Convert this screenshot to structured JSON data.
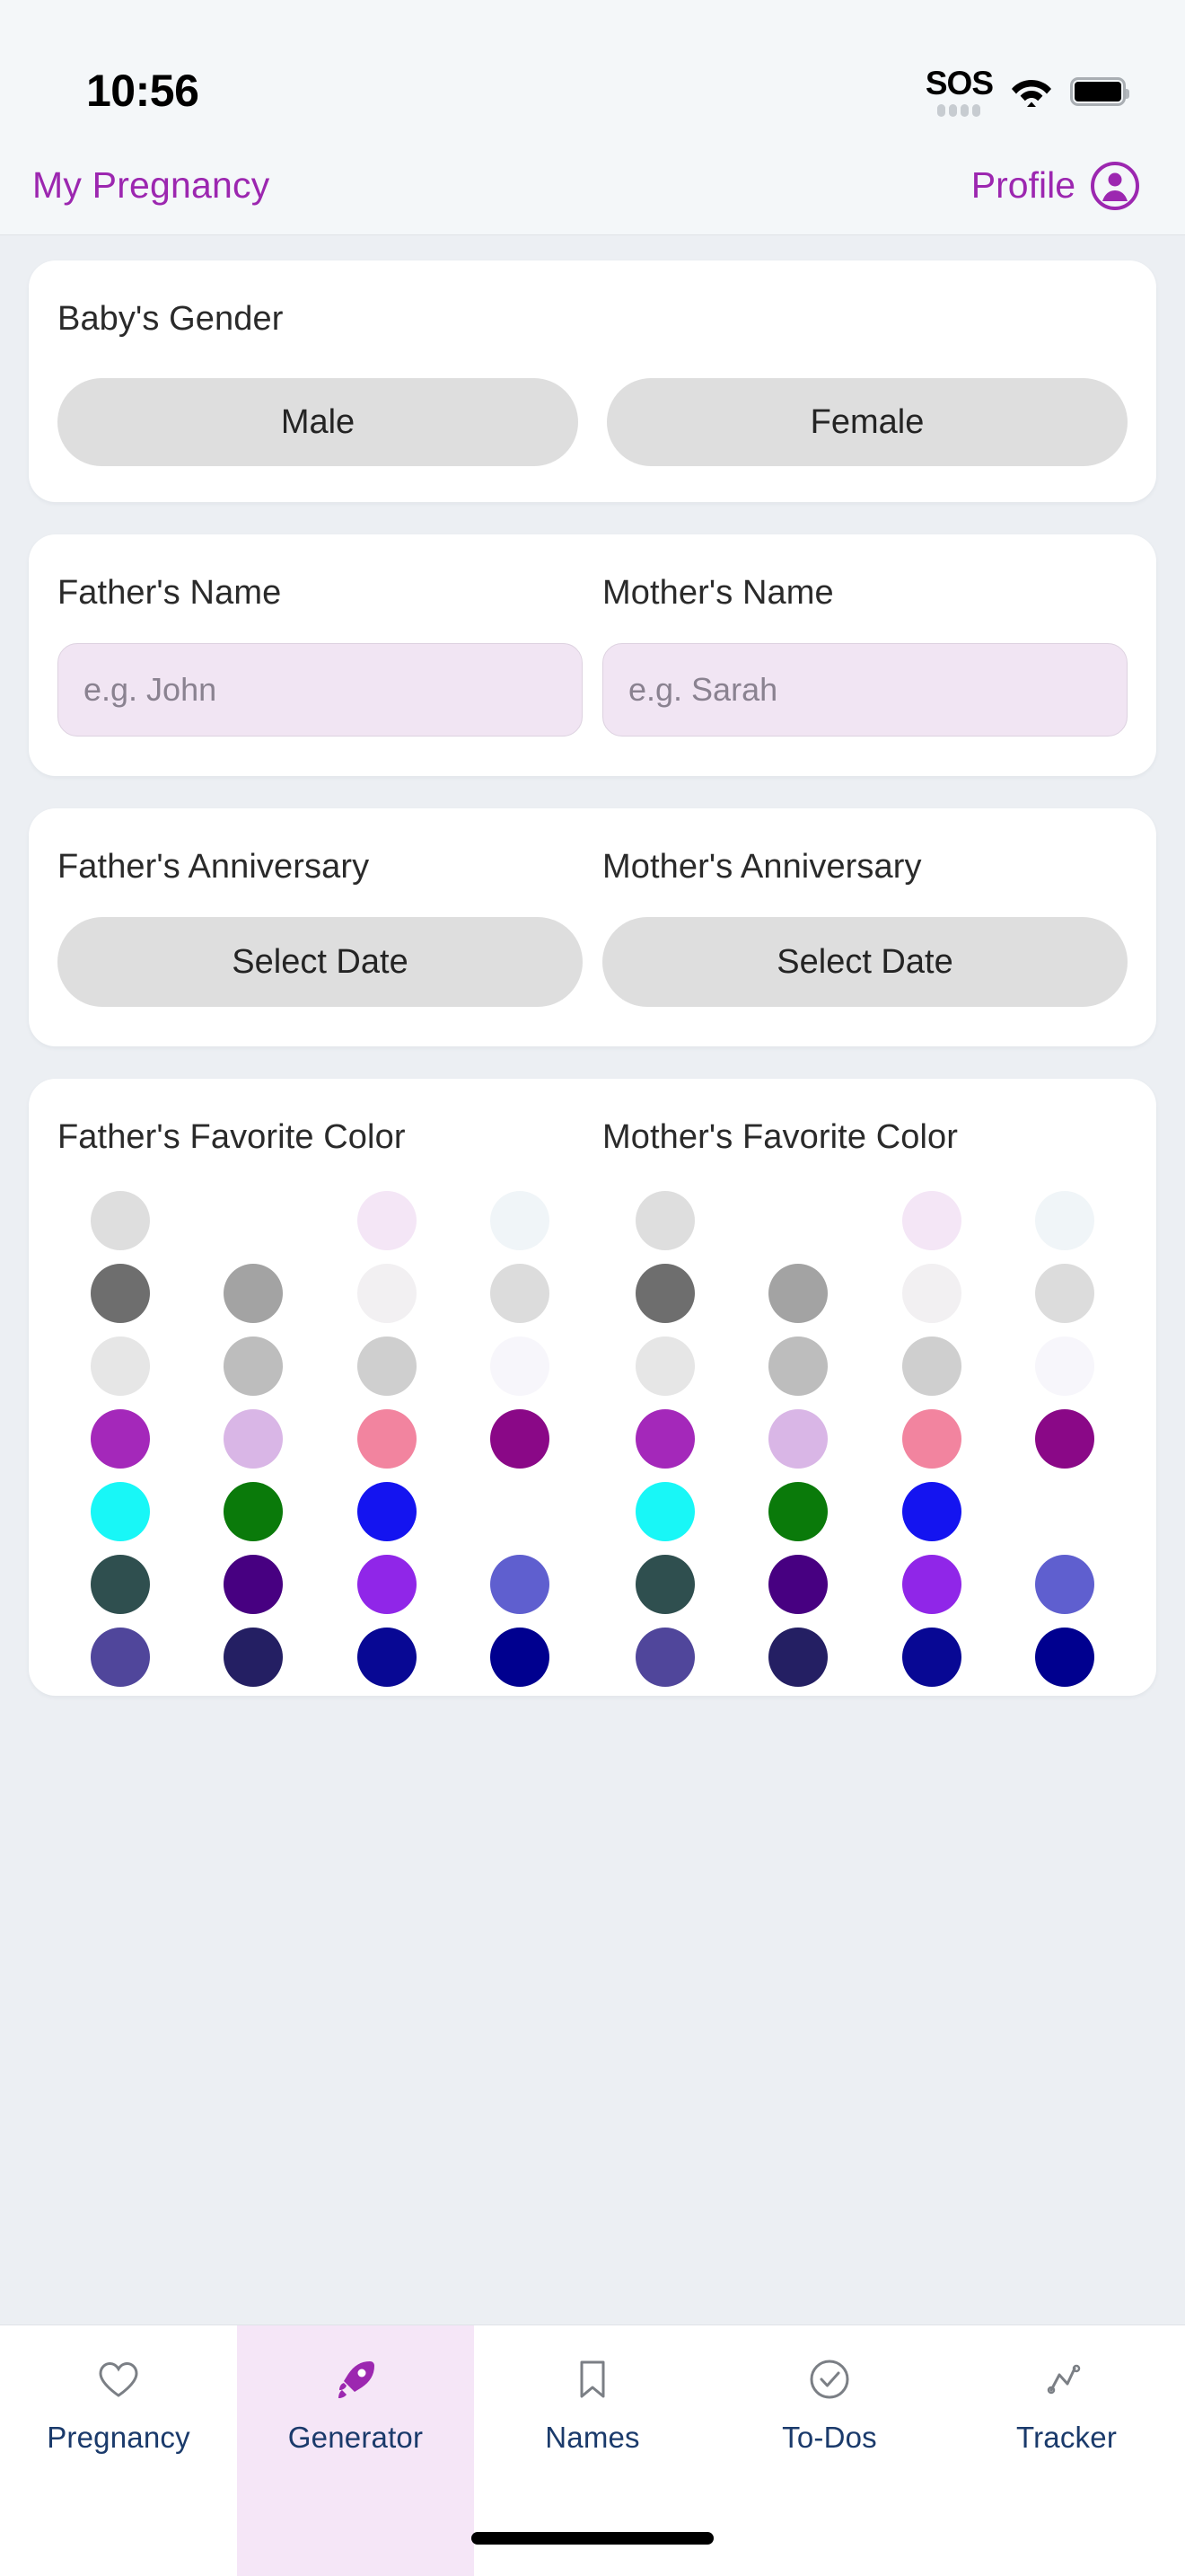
{
  "status_bar": {
    "time": "10:56",
    "sos_label": "SOS",
    "wifi_icon": "wifi-icon",
    "battery_icon": "battery-icon"
  },
  "header": {
    "title": "My Pregnancy",
    "profile_label": "Profile",
    "profile_icon": "avatar-icon",
    "accent_color": "#9c27b0"
  },
  "gender_card": {
    "label": "Baby's Gender",
    "options": [
      "Male",
      "Female"
    ]
  },
  "names_card": {
    "father": {
      "label": "Father's Name",
      "value": "",
      "placeholder": "e.g. John"
    },
    "mother": {
      "label": "Mother's Name",
      "value": "",
      "placeholder": "e.g. Sarah"
    }
  },
  "anniversary_card": {
    "father": {
      "label": "Father's Anniversary",
      "button": "Select Date"
    },
    "mother": {
      "label": "Mother's Anniversary",
      "button": "Select Date"
    }
  },
  "color_card": {
    "father_label": "Father's Favorite Color",
    "mother_label": "Mother's Favorite Color",
    "swatches": [
      "#dedede",
      "",
      "#f4e6f6",
      "#f0f5f8",
      "#6e6e6e",
      "#a3a3a3",
      "#f2f0f2",
      "#dcdcdc",
      "#e6e6e6",
      "#bdbdbd",
      "#cfcfcf",
      "#f7f6fb",
      "#a428ba",
      "#d9b6e6",
      "#f2849f",
      "#8a0887",
      "#18f7f7",
      "#0a7a0a",
      "#1414f0",
      "",
      "#2f4f4f",
      "#470081",
      "#9026e8",
      "#5f5fcf",
      "#50469b",
      "#241f63",
      "#080894",
      "#00008f"
    ]
  },
  "tabs": [
    {
      "label": "Pregnancy",
      "icon": "heart-icon",
      "active": false
    },
    {
      "label": "Generator",
      "icon": "rocket-icon",
      "active": true
    },
    {
      "label": "Names",
      "icon": "bookmark-icon",
      "active": false
    },
    {
      "label": "To-Dos",
      "icon": "check-circle-icon",
      "active": false
    },
    {
      "label": "Tracker",
      "icon": "chart-line-icon",
      "active": false
    }
  ]
}
